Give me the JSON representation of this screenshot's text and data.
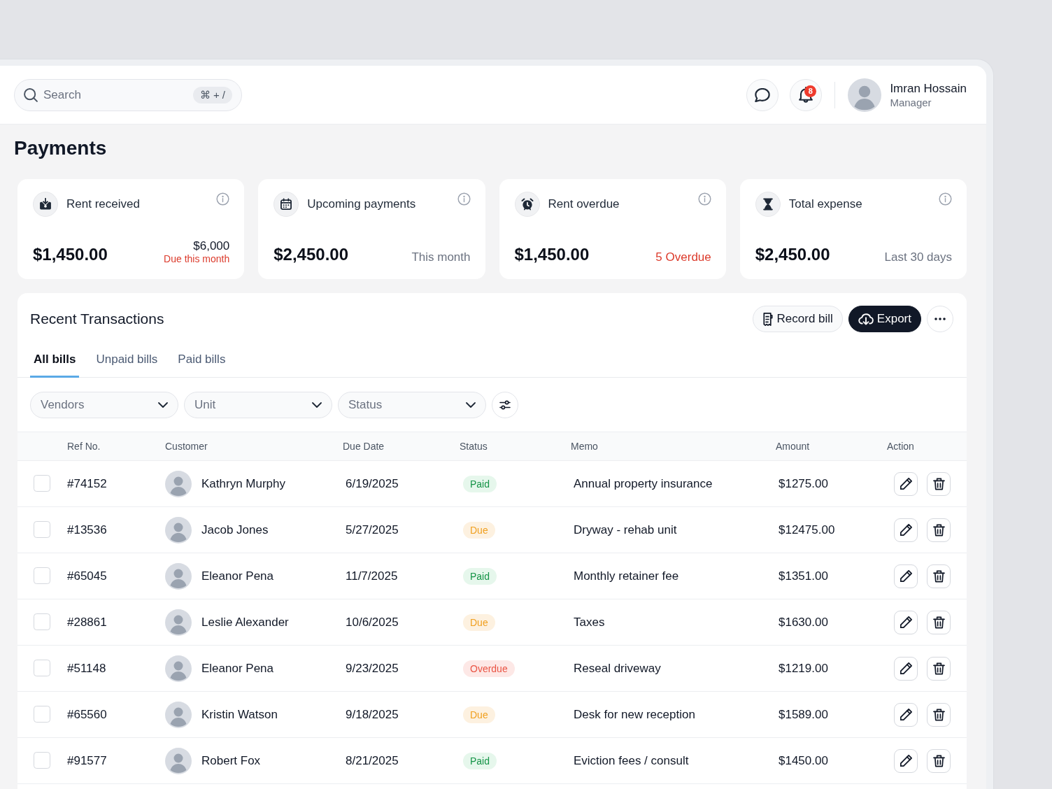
{
  "header": {
    "search": {
      "placeholder": "Search",
      "shortcut": "⌘ + /"
    },
    "notifications": {
      "count": "8"
    },
    "user": {
      "name": "Imran Hossain",
      "role": "Manager"
    }
  },
  "page": {
    "title": "Payments"
  },
  "stats": [
    {
      "kind": "received",
      "title": "Rent received",
      "value": "$1,450.00",
      "amount": "$6,000",
      "note": {
        "text": "Due this month",
        "kind": "danger"
      }
    },
    {
      "kind": "upcoming",
      "title": "Upcoming payments",
      "value": "$2,450.00",
      "note": {
        "text": "This month",
        "kind": "muted"
      }
    },
    {
      "kind": "overdue",
      "title": "Rent overdue",
      "value": "$1,450.00",
      "note": {
        "text": "5 Overdue",
        "kind": "danger"
      }
    },
    {
      "kind": "expense",
      "title": "Total expense",
      "value": "$2,450.00",
      "note": {
        "text": "Last 30 days",
        "kind": "muted"
      }
    }
  ],
  "transactions": {
    "title": "Recent Transactions",
    "actions": [
      {
        "label": "Record bill",
        "kind": "outline"
      },
      {
        "label": "Export",
        "kind": "dark"
      }
    ],
    "tabs": [
      {
        "label": "All bills",
        "selected": true
      },
      {
        "label": "Unpaid bills",
        "selected": false
      },
      {
        "label": "Paid bills",
        "selected": false
      }
    ],
    "filters": [
      {
        "placeholder": "Vendors"
      },
      {
        "placeholder": "Unit"
      },
      {
        "placeholder": "Status"
      }
    ],
    "table": {
      "columns": [
        "Ref No.",
        "Customer",
        "Due Date",
        "Status",
        "Memo",
        "Amount",
        "Action"
      ],
      "rows": [
        {
          "checked": false,
          "ref": "#74152",
          "customer": "Kathryn Murphy",
          "due_date": "6/19/2025",
          "status": {
            "label": "Paid",
            "kind": "paid"
          },
          "memo": "Annual property insurance",
          "amount": "$1275.00"
        },
        {
          "checked": false,
          "ref": "#13536",
          "customer": "Jacob Jones",
          "due_date": "5/27/2025",
          "status": {
            "label": "Due",
            "kind": "due"
          },
          "memo": "Dryway - rehab unit",
          "amount": "$12475.00"
        },
        {
          "checked": false,
          "ref": "#65045",
          "customer": "Eleanor Pena",
          "due_date": "11/7/2025",
          "status": {
            "label": "Paid",
            "kind": "paid"
          },
          "memo": "Monthly retainer fee",
          "amount": "$1351.00"
        },
        {
          "checked": false,
          "ref": "#28861",
          "customer": "Leslie Alexander",
          "due_date": "10/6/2025",
          "status": {
            "label": "Due",
            "kind": "due"
          },
          "memo": "Taxes",
          "amount": "$1630.00"
        },
        {
          "checked": false,
          "ref": "#51148",
          "customer": "Eleanor Pena",
          "due_date": "9/23/2025",
          "status": {
            "label": "Overdue",
            "kind": "overdue"
          },
          "memo": "Reseal driveway",
          "amount": "$1219.00"
        },
        {
          "checked": false,
          "ref": "#65560",
          "customer": "Kristin Watson",
          "due_date": "9/18/2025",
          "status": {
            "label": "Due",
            "kind": "due"
          },
          "memo": "Desk for new reception",
          "amount": "$1589.00"
        },
        {
          "checked": false,
          "ref": "#91577",
          "customer": "Robert Fox",
          "due_date": "8/21/2025",
          "status": {
            "label": "Paid",
            "kind": "paid"
          },
          "memo": "Eviction fees / consult",
          "amount": "$1450.00"
        }
      ]
    }
  }
}
